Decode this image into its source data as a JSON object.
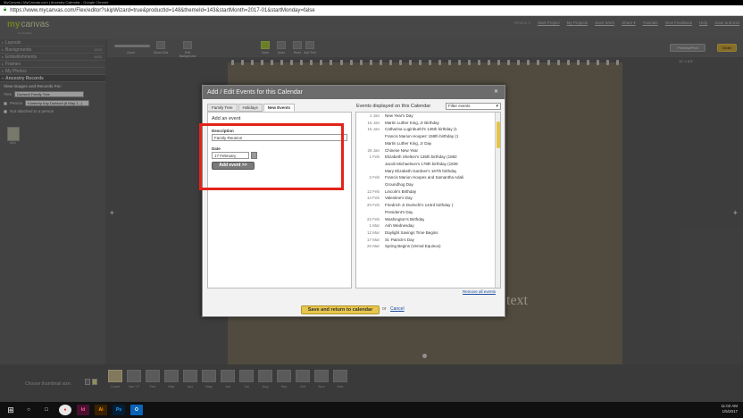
{
  "browser": {
    "window_title": "MyCanvas | MyCanvas.com | Ancestry Calendar - Google Chrome",
    "url": "https://www.mycanvas.com/Flex/editor?skipWizard=true&productId=148&themeId=143&startMonth=2017-01&startMonday=false"
  },
  "header": {
    "logo_my": "my",
    "logo_canvas": "canvas",
    "logo_sub": "by ancestry",
    "version": "Version 4",
    "nav": [
      "Start Project",
      "My Projects",
      "Save Work",
      "Share ▾",
      "Tutorials",
      "Give Feedback",
      "Help",
      "Save and Exit"
    ]
  },
  "toolbar": {
    "zoom_label": "Zoom",
    "tools": [
      "Show Grid",
      "Edit Background",
      "Save",
      "Undo",
      "Redo",
      "Add Text"
    ],
    "preview_label": "Preview/Print",
    "order_label": "Order",
    "page_size": "11\" x 8.5\""
  },
  "sidebar": {
    "items": [
      {
        "label": "Layouts",
        "count": ""
      },
      {
        "label": "Backgrounds",
        "count": "1823"
      },
      {
        "label": "Embellishments",
        "count": "4653"
      },
      {
        "label": "Frames",
        "count": ""
      },
      {
        "label": "My Photos",
        "count": ""
      },
      {
        "label": "Ancestry Records",
        "count": ""
      }
    ],
    "view_label": "View Images and Records For:",
    "tree_label": "Tree",
    "tree_value": "Durtschi Family Tree",
    "person_label": "Person",
    "person_value": "Kimberly Kay Durtschi (8 May 1...)",
    "not_attached": "Not attached to a person",
    "thumb_caption": "Birth"
  },
  "canvas": {
    "text": "text"
  },
  "filmstrip": {
    "label": "Choose thumbnail size:",
    "thumbs": [
      "Cover",
      "Jan '17",
      "Feb",
      "Mar",
      "Apr",
      "May",
      "Jun",
      "Jul",
      "Aug",
      "Sep",
      "Oct",
      "Nov",
      "Dec"
    ]
  },
  "dialog": {
    "title": "Add / Edit Events for this Calendar",
    "tabs": [
      "Family Tree",
      "Holidays",
      "New Events"
    ],
    "add_event_title": "Add an event",
    "description_label": "Description",
    "description_value": "Family Reunion",
    "date_label": "Date",
    "date_value": "17 February",
    "add_button": "Add event >>",
    "events_title": "Events displayed on this Calendar",
    "filter_value": "Filter events",
    "events": [
      {
        "date": "1 Jan",
        "name": "New Year's Day"
      },
      {
        "date": "16 Jan",
        "name": "Martin Luther King, Jr Birthday"
      },
      {
        "date": "16 Jan",
        "name": "Catharina Luginbuehl's 145th birthday (1"
      },
      {
        "date": "",
        "name": "Francis Marion Hoopes' 158th birthday (1"
      },
      {
        "date": "",
        "name": "Martin Luther King, Jr Day"
      },
      {
        "date": "28 Jan",
        "name": "Chinese New Year"
      },
      {
        "date": "1 Feb",
        "name": "Elizabeth Shelton's 135th birthday (1882"
      },
      {
        "date": "",
        "name": "Jacob Michaelson's 178th birthday (1839"
      },
      {
        "date": "",
        "name": "Mary Elizabeth Gardner's 167th birthday"
      },
      {
        "date": "2 Feb",
        "name": "Francis Marion Hoopes and Samantha Adali"
      },
      {
        "date": "",
        "name": "Groundhog Day"
      },
      {
        "date": "12 Feb",
        "name": "Lincoln's Birthday"
      },
      {
        "date": "14 Feb",
        "name": "Valentine's Day"
      },
      {
        "date": "20 Feb",
        "name": "Friedrich Jr Durtschi's 143rd birthday ("
      },
      {
        "date": "",
        "name": "President's Day"
      },
      {
        "date": "22 Feb",
        "name": "Washington's Birthday"
      },
      {
        "date": "1 Mar",
        "name": "Ash Wednesday"
      },
      {
        "date": "12 Mar",
        "name": "Daylight Savings Time Begins"
      },
      {
        "date": "17 Mar",
        "name": "St. Patrick's Day"
      },
      {
        "date": "20 Mar",
        "name": "Spring Begins (Vernal Equinox)"
      }
    ],
    "remove_all": "Remove all events",
    "save_button": "Save and return to calendar",
    "or_text": "or",
    "cancel_link": "Cancel"
  },
  "taskbar": {
    "time": "11:02 AM",
    "date": "1/5/2017",
    "apps": [
      "Chrome",
      "InDesign",
      "Illustrator",
      "Photoshop",
      "Outlook"
    ]
  }
}
